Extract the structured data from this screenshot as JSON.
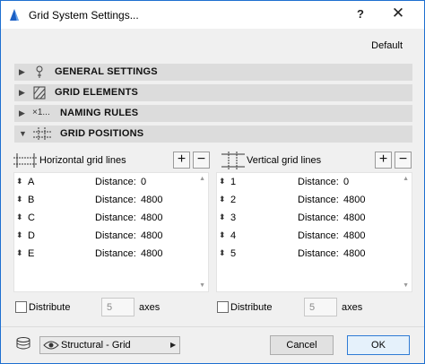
{
  "window": {
    "title": "Grid System Settings...",
    "help_label": "?",
    "close_label": "✕"
  },
  "preset": "Default",
  "sections": [
    {
      "label": "GENERAL SETTINGS",
      "icon": "pin-icon",
      "expanded": false
    },
    {
      "label": "GRID ELEMENTS",
      "icon": "grid-element-icon",
      "expanded": false
    },
    {
      "label": "NAMING RULES",
      "icon_text": "×1...",
      "expanded": false
    },
    {
      "label": "GRID POSITIONS",
      "icon": "grid-positions-icon",
      "expanded": true
    }
  ],
  "horizontal": {
    "label": "Horizontal grid lines",
    "add_label": "+",
    "remove_label": "−",
    "rows": [
      {
        "name": "A",
        "distance_label": "Distance:",
        "distance": "0"
      },
      {
        "name": "B",
        "distance_label": "Distance:",
        "distance": "4800"
      },
      {
        "name": "C",
        "distance_label": "Distance:",
        "distance": "4800"
      },
      {
        "name": "D",
        "distance_label": "Distance:",
        "distance": "4800"
      },
      {
        "name": "E",
        "distance_label": "Distance:",
        "distance": "4800"
      }
    ],
    "distribute_label": "Distribute",
    "distribute_checked": false,
    "axes_count": "5",
    "axes_label": "axes"
  },
  "vertical": {
    "label": "Vertical grid lines",
    "add_label": "+",
    "remove_label": "−",
    "rows": [
      {
        "name": "1",
        "distance_label": "Distance:",
        "distance": "0"
      },
      {
        "name": "2",
        "distance_label": "Distance:",
        "distance": "4800"
      },
      {
        "name": "3",
        "distance_label": "Distance:",
        "distance": "4800"
      },
      {
        "name": "4",
        "distance_label": "Distance:",
        "distance": "4800"
      },
      {
        "name": "5",
        "distance_label": "Distance:",
        "distance": "4800"
      }
    ],
    "distribute_label": "Distribute",
    "distribute_checked": false,
    "axes_count": "5",
    "axes_label": "axes"
  },
  "footer": {
    "layer": "Structural - Grid",
    "cancel_label": "Cancel",
    "ok_label": "OK"
  },
  "colors": {
    "window_border": "#1e6fd0",
    "section_bg": "#dcdcdc",
    "ok_border": "#2f7bd5"
  }
}
